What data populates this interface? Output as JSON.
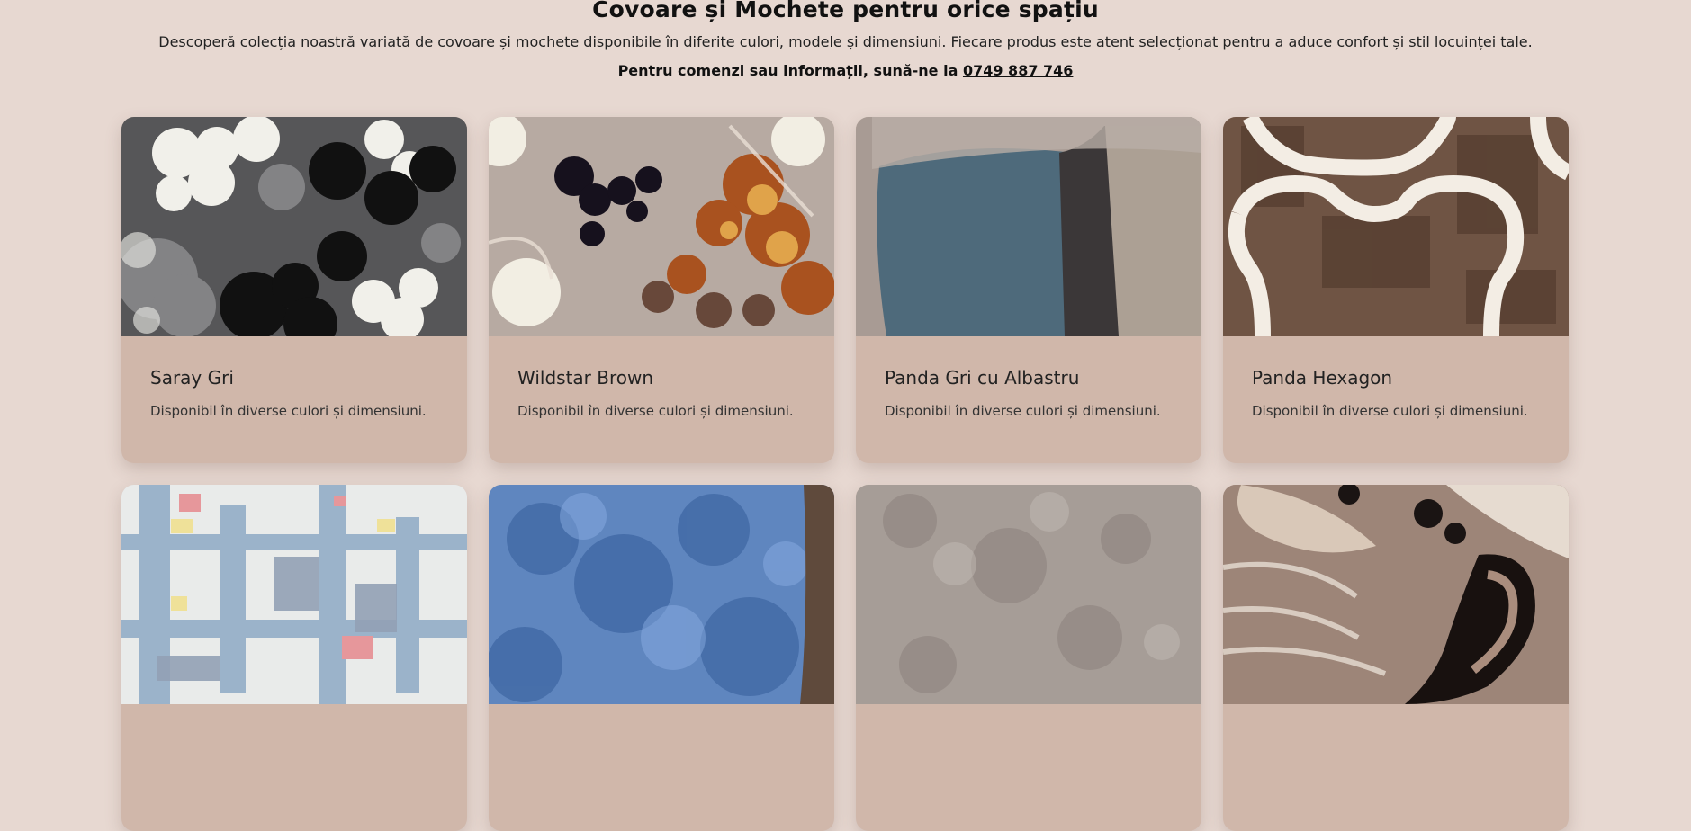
{
  "header": {
    "title": "Covoare și Mochete pentru orice spațiu",
    "subtitle": "Descoperă colecția noastră variată de covoare și mochete disponibile în diferite culori, modele și dimensiuni. Fiecare produs este atent selecționat pentru a aduce confort și stil locuinței tale.",
    "contact_prefix": "Pentru comenzi sau informații, sună-ne la ",
    "phone": "0749 887 746"
  },
  "products": [
    {
      "name": "Saray Gri",
      "description": "Disponibil în diverse culori și dimensiuni.",
      "image_icon": "floral-gray-carpet-image"
    },
    {
      "name": "Wildstar Brown",
      "description": "Disponibil în diverse culori și dimensiuni.",
      "image_icon": "brown-floral-carpet-image"
    },
    {
      "name": "Panda Gri cu Albastru",
      "description": "Disponibil în diverse culori și dimensiuni.",
      "image_icon": "gray-blue-striped-carpet-image"
    },
    {
      "name": "Panda Hexagon",
      "description": "Disponibil în diverse culori și dimensiuni.",
      "image_icon": "hexagon-carpet-image"
    },
    {
      "image_icon": "abstract-blue-carpet-image"
    },
    {
      "image_icon": "blue-shag-carpet-image"
    },
    {
      "image_icon": "gray-loop-carpet-image"
    },
    {
      "image_icon": "paisley-carpet-image"
    }
  ],
  "colors": {
    "page_background": "#e7d8d1",
    "card_background": "#d0b7aa",
    "text": "#111111"
  }
}
